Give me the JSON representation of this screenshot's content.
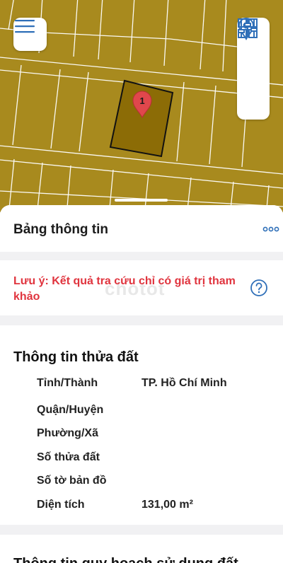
{
  "map": {
    "marker_label": "1",
    "colors": {
      "land": "#a88a1e",
      "parcel_fill": "#8c6c06",
      "lines": "#ffffff",
      "marker": "#e0474c"
    }
  },
  "toolbar": {
    "menu_icon": "hamburger-icon",
    "tools": [
      "grid-icon",
      "location-pin-icon",
      "sliders-icon"
    ]
  },
  "panel": {
    "title": "Bảng thông tin",
    "more_icon": "more-horizontal-icon",
    "warning": "Lưu ý: Kết quả tra cứu chỉ có giá trị tham khảo",
    "help_icon": "help-circle-icon",
    "watermark": "chotot"
  },
  "parcel_info": {
    "title": "Thông tin thửa đất",
    "rows": [
      {
        "label": "Tỉnh/Thành",
        "value": "TP. Hồ Chí Minh"
      },
      {
        "label": "Quận/Huyện",
        "value": ""
      },
      {
        "label": "Phường/Xã",
        "value": ""
      },
      {
        "label": "Số thửa đất",
        "value": ""
      },
      {
        "label": "Số tờ bản đồ",
        "value": ""
      },
      {
        "label": "Diện tích",
        "value": "131,00 m²"
      }
    ]
  },
  "next_section": {
    "title": "Thông tin quy hoạch sử dụng đất"
  },
  "colors": {
    "warning": "#e0343e",
    "accent": "#2f6fb8",
    "background": "#f1f1f3"
  }
}
